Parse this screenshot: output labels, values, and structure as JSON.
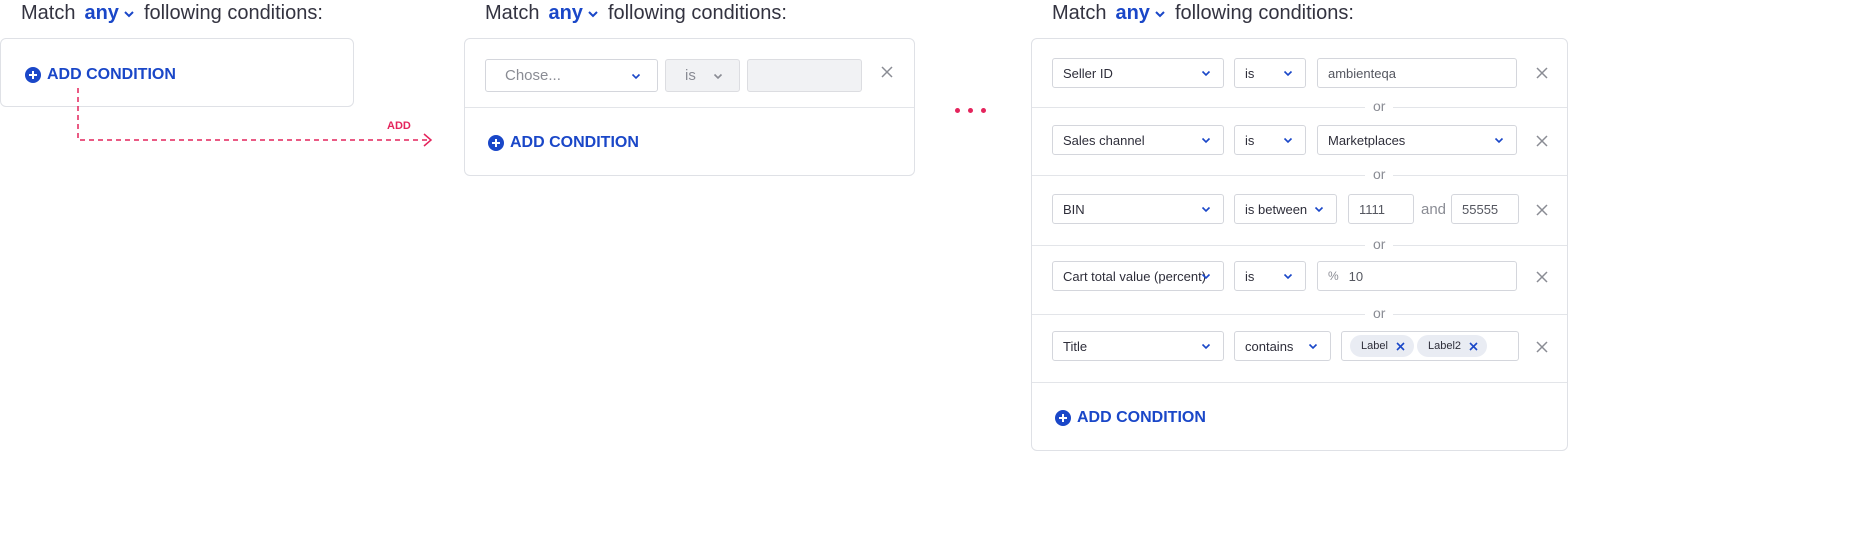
{
  "step1": {
    "match_prefix": "Match",
    "match_value": "any",
    "match_suffix": "following conditions:",
    "add_condition": "ADD CONDITION"
  },
  "arrow_label": "ADD",
  "step2": {
    "match_prefix": "Match",
    "match_value": "any",
    "match_suffix": "following conditions:",
    "field_placeholder": "Chose...",
    "operator": "is",
    "value": "",
    "add_condition": "ADD CONDITION"
  },
  "step3": {
    "match_prefix": "Match",
    "match_value": "any",
    "match_suffix": "following conditions:",
    "or_label": "or",
    "conditions": [
      {
        "field": "Seller ID",
        "operator": "is",
        "value": "ambienteqa"
      },
      {
        "field": "Sales channel",
        "operator": "is",
        "value": "Marketplaces"
      },
      {
        "field": "BIN",
        "operator": "is between",
        "value_from": "1111",
        "and_label": "and",
        "value_to": "55555"
      },
      {
        "field": "Cart total value (percent)",
        "operator": "is",
        "prefix": "%",
        "value": "10"
      },
      {
        "field": "Title",
        "operator": "contains",
        "tags": [
          "Label",
          "Label2"
        ]
      }
    ],
    "add_condition": "ADD CONDITION"
  },
  "colors": {
    "accent": "#1a47c8",
    "arrow": "#e4245c",
    "border": "#dfe1e6",
    "muted": "#8a8c94"
  }
}
